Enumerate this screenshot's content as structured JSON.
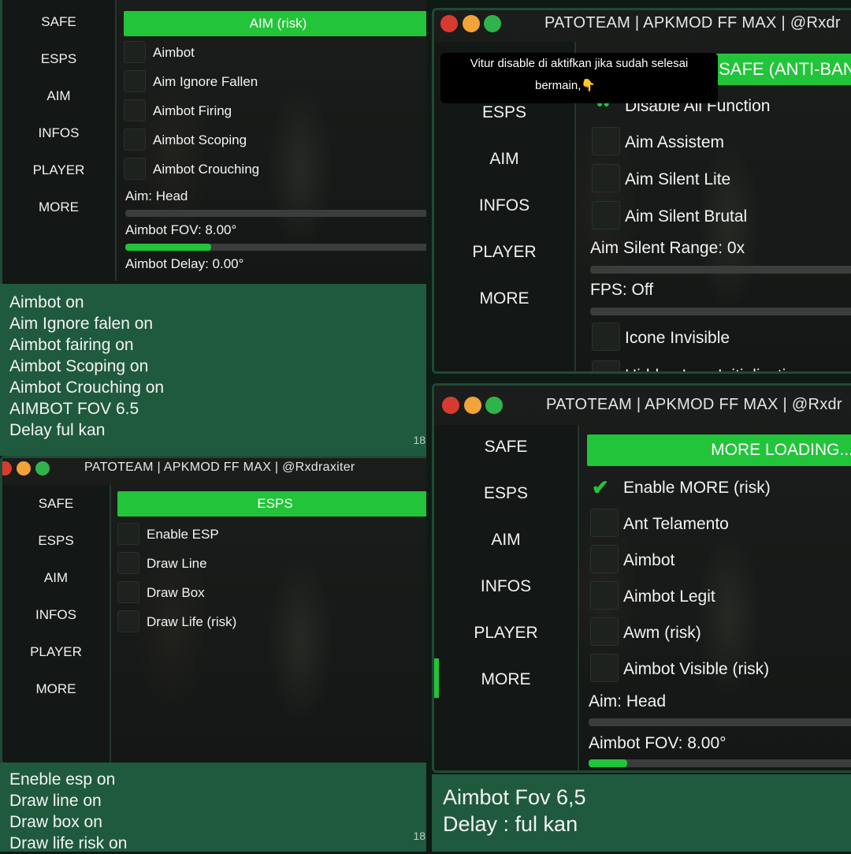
{
  "colors": {
    "accent": "#22c43a",
    "caption_bg": "#1f5a3e",
    "panel_border": "#1f4a35"
  },
  "sidebar_items": [
    "SAFE",
    "ESPS",
    "AIM",
    "INFOS",
    "PLAYER",
    "MORE"
  ],
  "sidebar_items_no_safe": [
    "ESPS",
    "AIM",
    "INFOS",
    "PLAYER",
    "MORE"
  ],
  "panel_tl": {
    "section_title": "AIM (risk)",
    "options": [
      "Aimbot",
      "Aim Ignore Fallen",
      "Aimbot Firing",
      "Aimbot Scoping",
      "Aimbot Crouching"
    ],
    "aim_label": "Aim:  Head",
    "fov_label": "Aimbot FOV: 8.00°",
    "fov_fill": 0.28,
    "delay_label": "Aimbot Delay: 0.00°"
  },
  "caption_tl": {
    "lines": [
      "Aimbot on",
      "Aim Ignore falen on",
      "Aimbot fairing on",
      "Aimbot Scoping on",
      "Aimbot Crouching on",
      "AIMBOT FOV 6.5",
      "Delay ful kan"
    ],
    "timestamp": "18"
  },
  "panel_tr": {
    "title": "PATOTEAM | APKMOD FF MAX | @Rxdr",
    "tooltip_line1": "Vitur disable di aktifkan jika sudah selesai",
    "tooltip_line2": "bermain,👇",
    "section_title": "SAFE (ANTI-BAN)",
    "options": [
      "Disable All Function",
      "Aim Assistem",
      "Aim Silent Lite",
      "Aim Silent Brutal"
    ],
    "range_label": "Aim Silent Range: 0x",
    "fps_label": "FPS:  Off",
    "options2": [
      "Icone Invisible",
      "Hidden Icon Initialization"
    ]
  },
  "panel_bl": {
    "title": "PATOTEAM | APKMOD FF MAX | @Rxdraxiter",
    "section_title": "ESPS",
    "options": [
      "Enable ESP",
      "Draw Line",
      "Draw Box",
      "Draw Life (risk)"
    ]
  },
  "caption_bl": {
    "lines": [
      "Eneble esp on",
      "Draw line on",
      "Draw box on",
      "Draw life risk on"
    ],
    "timestamp": "18"
  },
  "panel_br": {
    "title": "PATOTEAM | APKMOD FF MAX | @Rxdr",
    "section_title": "MORE LOADING...",
    "options": [
      "Enable MORE (risk)",
      "Ant Telamento",
      "Aimbot",
      "Aimbot Legit",
      "Awm (risk)",
      "Aimbot Visible (risk)"
    ],
    "aim_label": "Aim:  Head",
    "fov_label": "Aimbot FOV: 8.00°",
    "fov_fill": 0.14
  },
  "caption_br": {
    "lines": [
      "Aimbot Fov  6,5",
      "Delay : ful kan"
    ]
  }
}
